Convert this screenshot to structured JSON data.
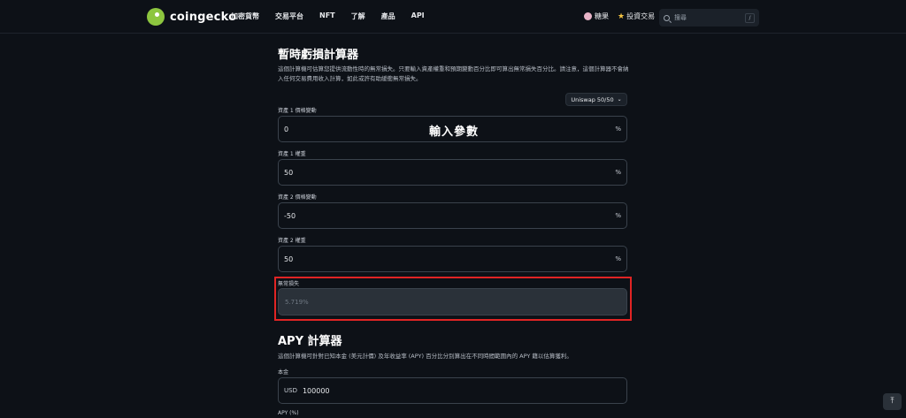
{
  "nav": {
    "brand": "coingecko",
    "links": [
      "加密貨幣",
      "交易平台",
      "NFT",
      "了解",
      "產品",
      "API"
    ],
    "candy": "糖果",
    "invest": "投資交易",
    "search_placeholder": "搜尋",
    "search_shortcut": "/"
  },
  "il_calc": {
    "title": "暫時虧損計算器",
    "description": "這個計算機可估算您提供流動性時的無常損失。只要輸入資產權重和預期變動百分比即可算出無常損失百分比。請注意，這個計算器不會納入任何交易費用收入計算，如此或許有助緩衝無常損失。",
    "preset": "Uniswap 50/50",
    "overlay_label": "輸入參數",
    "fields": [
      {
        "label": "資產 1 價格變動",
        "value": "0",
        "unit": "%"
      },
      {
        "label": "資產 1 權重",
        "value": "50",
        "unit": "%"
      },
      {
        "label": "資產 2 價格變動",
        "value": "-50",
        "unit": "%"
      },
      {
        "label": "資產 2 權重",
        "value": "50",
        "unit": "%"
      }
    ],
    "result": {
      "label": "無常損失",
      "value": "5.719%"
    }
  },
  "apy_calc": {
    "title": "APY 計算器",
    "description": "這個計算機可針對已知本金 (美元計價) 及年收益率 (APY) 百分比分別算出在不同時間範圍內的 APY 藉以估算獲利。",
    "principal_label": "本金",
    "principal_prefix": "USD",
    "principal_value": "100000",
    "apy_label": "APY (%)"
  },
  "colors": {
    "highlight": "#e02424",
    "brand": "#8dc63f"
  },
  "icons": {
    "scroll_top": "arrow-up-icon"
  }
}
